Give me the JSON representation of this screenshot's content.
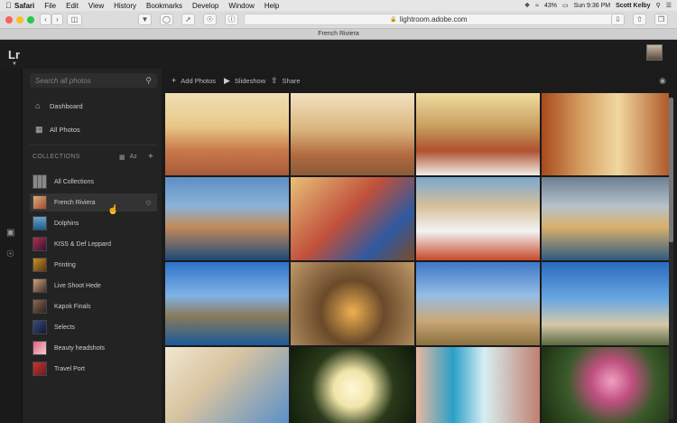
{
  "menubar": {
    "items": [
      "Safari",
      "File",
      "Edit",
      "View",
      "History",
      "Bookmarks",
      "Develop",
      "Window",
      "Help"
    ],
    "battery": "43%",
    "time": "Sun 9:36 PM",
    "user": "Scott Kelby"
  },
  "browser": {
    "url": "lightroom.adobe.com",
    "tab_title": "French Riviera"
  },
  "app": {
    "logo": "Lr"
  },
  "sidebar": {
    "search_placeholder": "Search all photos",
    "nav": [
      {
        "label": "Dashboard",
        "icon": "home-icon"
      },
      {
        "label": "All Photos",
        "icon": "photos-icon"
      }
    ],
    "collections_heading": "COLLECTIONS",
    "sort_label": "Az",
    "collections": [
      {
        "label": "All Collections"
      },
      {
        "label": "French Riviera",
        "selected": true
      },
      {
        "label": "Dolphins"
      },
      {
        "label": "KISS & Def Leppard"
      },
      {
        "label": "Printing"
      },
      {
        "label": "Live Shoot Hede"
      },
      {
        "label": "Kapok Finals"
      },
      {
        "label": "Selects"
      },
      {
        "label": "Beauty headshots"
      },
      {
        "label": "Travel Port"
      }
    ]
  },
  "main_toolbar": {
    "add_photos": "Add Photos",
    "slideshow": "Slideshow",
    "share": "Share"
  },
  "colors": {
    "accent": "#4a90d9",
    "background": "#1b1b1b"
  }
}
